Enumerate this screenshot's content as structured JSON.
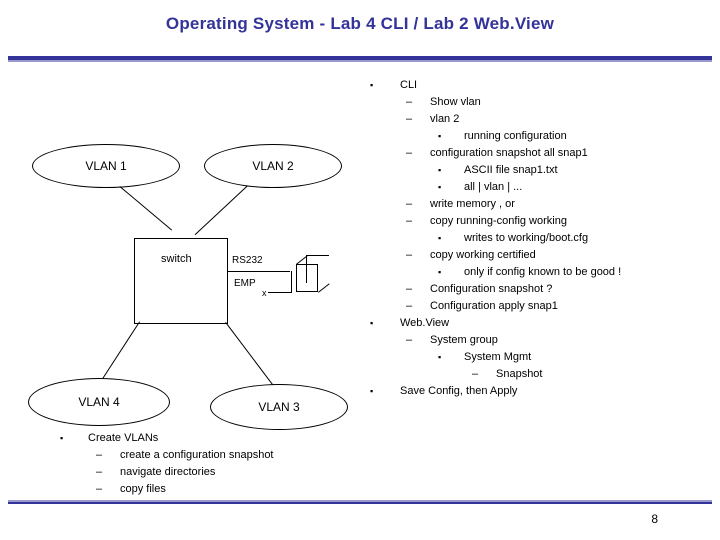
{
  "slide": {
    "title": "Operating System - Lab 4 CLI / Lab 2 Web.View",
    "page_number": "8"
  },
  "diagram": {
    "nodes": [
      {
        "label": "VLAN 1"
      },
      {
        "label": "VLAN 2"
      },
      {
        "label": "VLAN 4"
      },
      {
        "label": "VLAN 3"
      },
      {
        "label": "switch"
      }
    ],
    "ports": [
      {
        "label": "RS232"
      },
      {
        "label": "EMP"
      }
    ],
    "misc_label": "x"
  },
  "right_bullets": [
    {
      "level": 1,
      "mark": "▪",
      "text": "CLI"
    },
    {
      "level": 2,
      "mark": "–",
      "text": "Show vlan"
    },
    {
      "level": 2,
      "mark": "–",
      "text": "vlan 2"
    },
    {
      "level": 3,
      "mark": "▪",
      "text": "running configuration"
    },
    {
      "level": 2,
      "mark": "–",
      "text": "configuration snapshot all snap1"
    },
    {
      "level": 3,
      "mark": "▪",
      "text": "ASCII file snap1.txt"
    },
    {
      "level": 3,
      "mark": "▪",
      "text": "all | vlan | ..."
    },
    {
      "level": 2,
      "mark": "–",
      "text": "write memory , or"
    },
    {
      "level": 2,
      "mark": "–",
      "text": "copy running-config working"
    },
    {
      "level": 3,
      "mark": "▪",
      "text": "writes to working/boot.cfg"
    },
    {
      "level": 2,
      "mark": "–",
      "text": "copy working certified"
    },
    {
      "level": 3,
      "mark": "▪",
      "text": "only if config known to be good !"
    },
    {
      "level": 2,
      "mark": "–",
      "text": "Configuration snapshot ?"
    },
    {
      "level": 2,
      "mark": "–",
      "text": "Configuration apply snap1"
    },
    {
      "level": 1,
      "mark": "▪",
      "text": "Web.View"
    },
    {
      "level": 2,
      "mark": "–",
      "text": "System group"
    },
    {
      "level": 3,
      "mark": "▪",
      "text": "System Mgmt"
    },
    {
      "level": 4,
      "mark": "–",
      "text": "Snapshot"
    },
    {
      "level": 1,
      "mark": "▪",
      "text": "Save Config, then Apply"
    }
  ],
  "bottom_bullets": [
    {
      "level": 1,
      "mark": "▪",
      "text": "Create VLANs"
    },
    {
      "level": 2,
      "mark": "–",
      "text": "create a configuration snapshot"
    },
    {
      "level": 2,
      "mark": "–",
      "text": "navigate directories"
    },
    {
      "level": 2,
      "mark": "–",
      "text": "copy files"
    }
  ],
  "colors": {
    "title": "#333399",
    "rule_dark": "#333399",
    "rule_light": "#9999cc"
  }
}
